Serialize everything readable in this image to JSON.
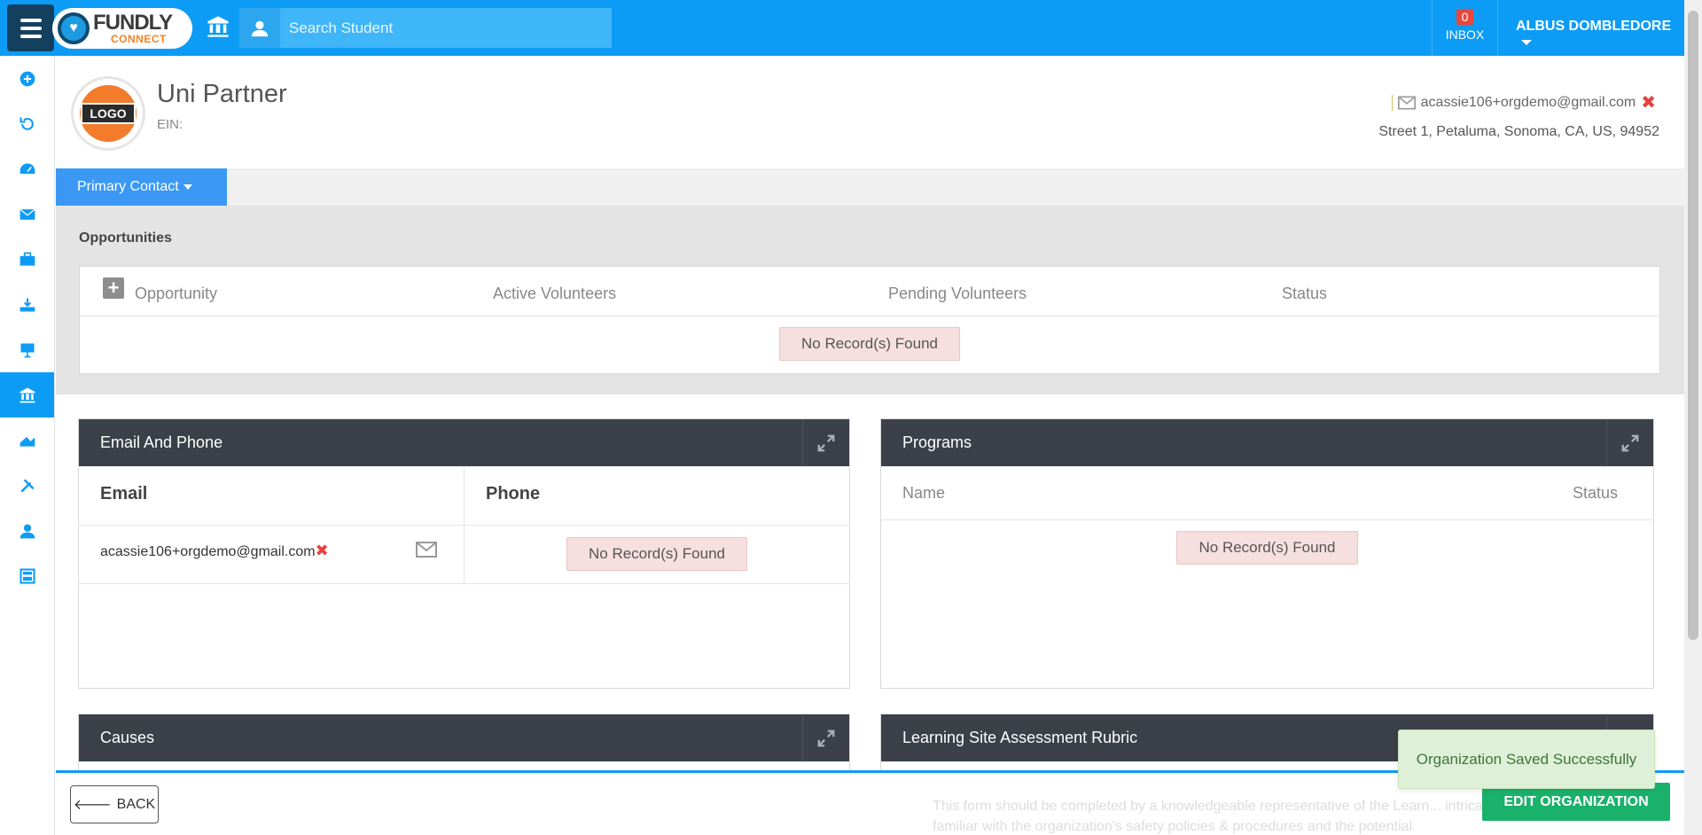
{
  "header": {
    "search_placeholder": "Search Student",
    "inbox_count": "0",
    "inbox_label": "INBOX",
    "user_name": "ALBUS DOMBLEDORE",
    "logo": {
      "title": "FUNDLY",
      "subtitle": "CONNECT"
    }
  },
  "sidebar": {
    "items": [
      {
        "icon": "plus-circle-icon",
        "active": false
      },
      {
        "icon": "refresh-icon",
        "active": false
      },
      {
        "icon": "dashboard-icon",
        "active": false
      },
      {
        "icon": "envelope-icon",
        "active": false
      },
      {
        "icon": "briefcase-icon",
        "active": false
      },
      {
        "icon": "download-icon",
        "active": false
      },
      {
        "icon": "presentation-icon",
        "active": false
      },
      {
        "icon": "bank-icon",
        "active": true
      },
      {
        "icon": "chart-icon",
        "active": false
      },
      {
        "icon": "tools-icon",
        "active": false
      },
      {
        "icon": "user-icon",
        "active": false
      },
      {
        "icon": "calculator-icon",
        "active": false
      }
    ]
  },
  "organization": {
    "logo_text": "LOGO",
    "name": "Uni Partner",
    "ein_label": "EIN:",
    "email": "acassie106+orgdemo@gmail.com",
    "address": "Street 1, Petaluma, Sonoma, CA, US, 94952"
  },
  "tabs": {
    "primary_contact": "Primary Contact"
  },
  "opportunities": {
    "title": "Opportunities",
    "columns": [
      "Opportunity",
      "Active Volunteers",
      "Pending Volunteers",
      "Status"
    ],
    "empty": "No Record(s) Found"
  },
  "email_phone": {
    "title": "Email And Phone",
    "email_col": "Email",
    "phone_col": "Phone",
    "email_value": "acassie106+orgdemo@gmail.com",
    "phone_empty": "No Record(s) Found"
  },
  "programs": {
    "title": "Programs",
    "name_col": "Name",
    "status_col": "Status",
    "empty": "No Record(s) Found"
  },
  "causes": {
    "title": "Causes"
  },
  "rubric": {
    "title": "Learning Site Assessment Rubric",
    "text": "This form should be completed by a knowledgeable representative of the Learn... intricately familiar with the organization's safety policies & procedures and the potential"
  },
  "actions": {
    "back": "BACK",
    "edit": "EDIT ORGANIZATION"
  },
  "toast": "Organization Saved Successfully",
  "colors": {
    "primary": "#0d9cf5",
    "dark_header": "#3b4049",
    "success": "#1ab26b",
    "danger": "#e84040"
  }
}
